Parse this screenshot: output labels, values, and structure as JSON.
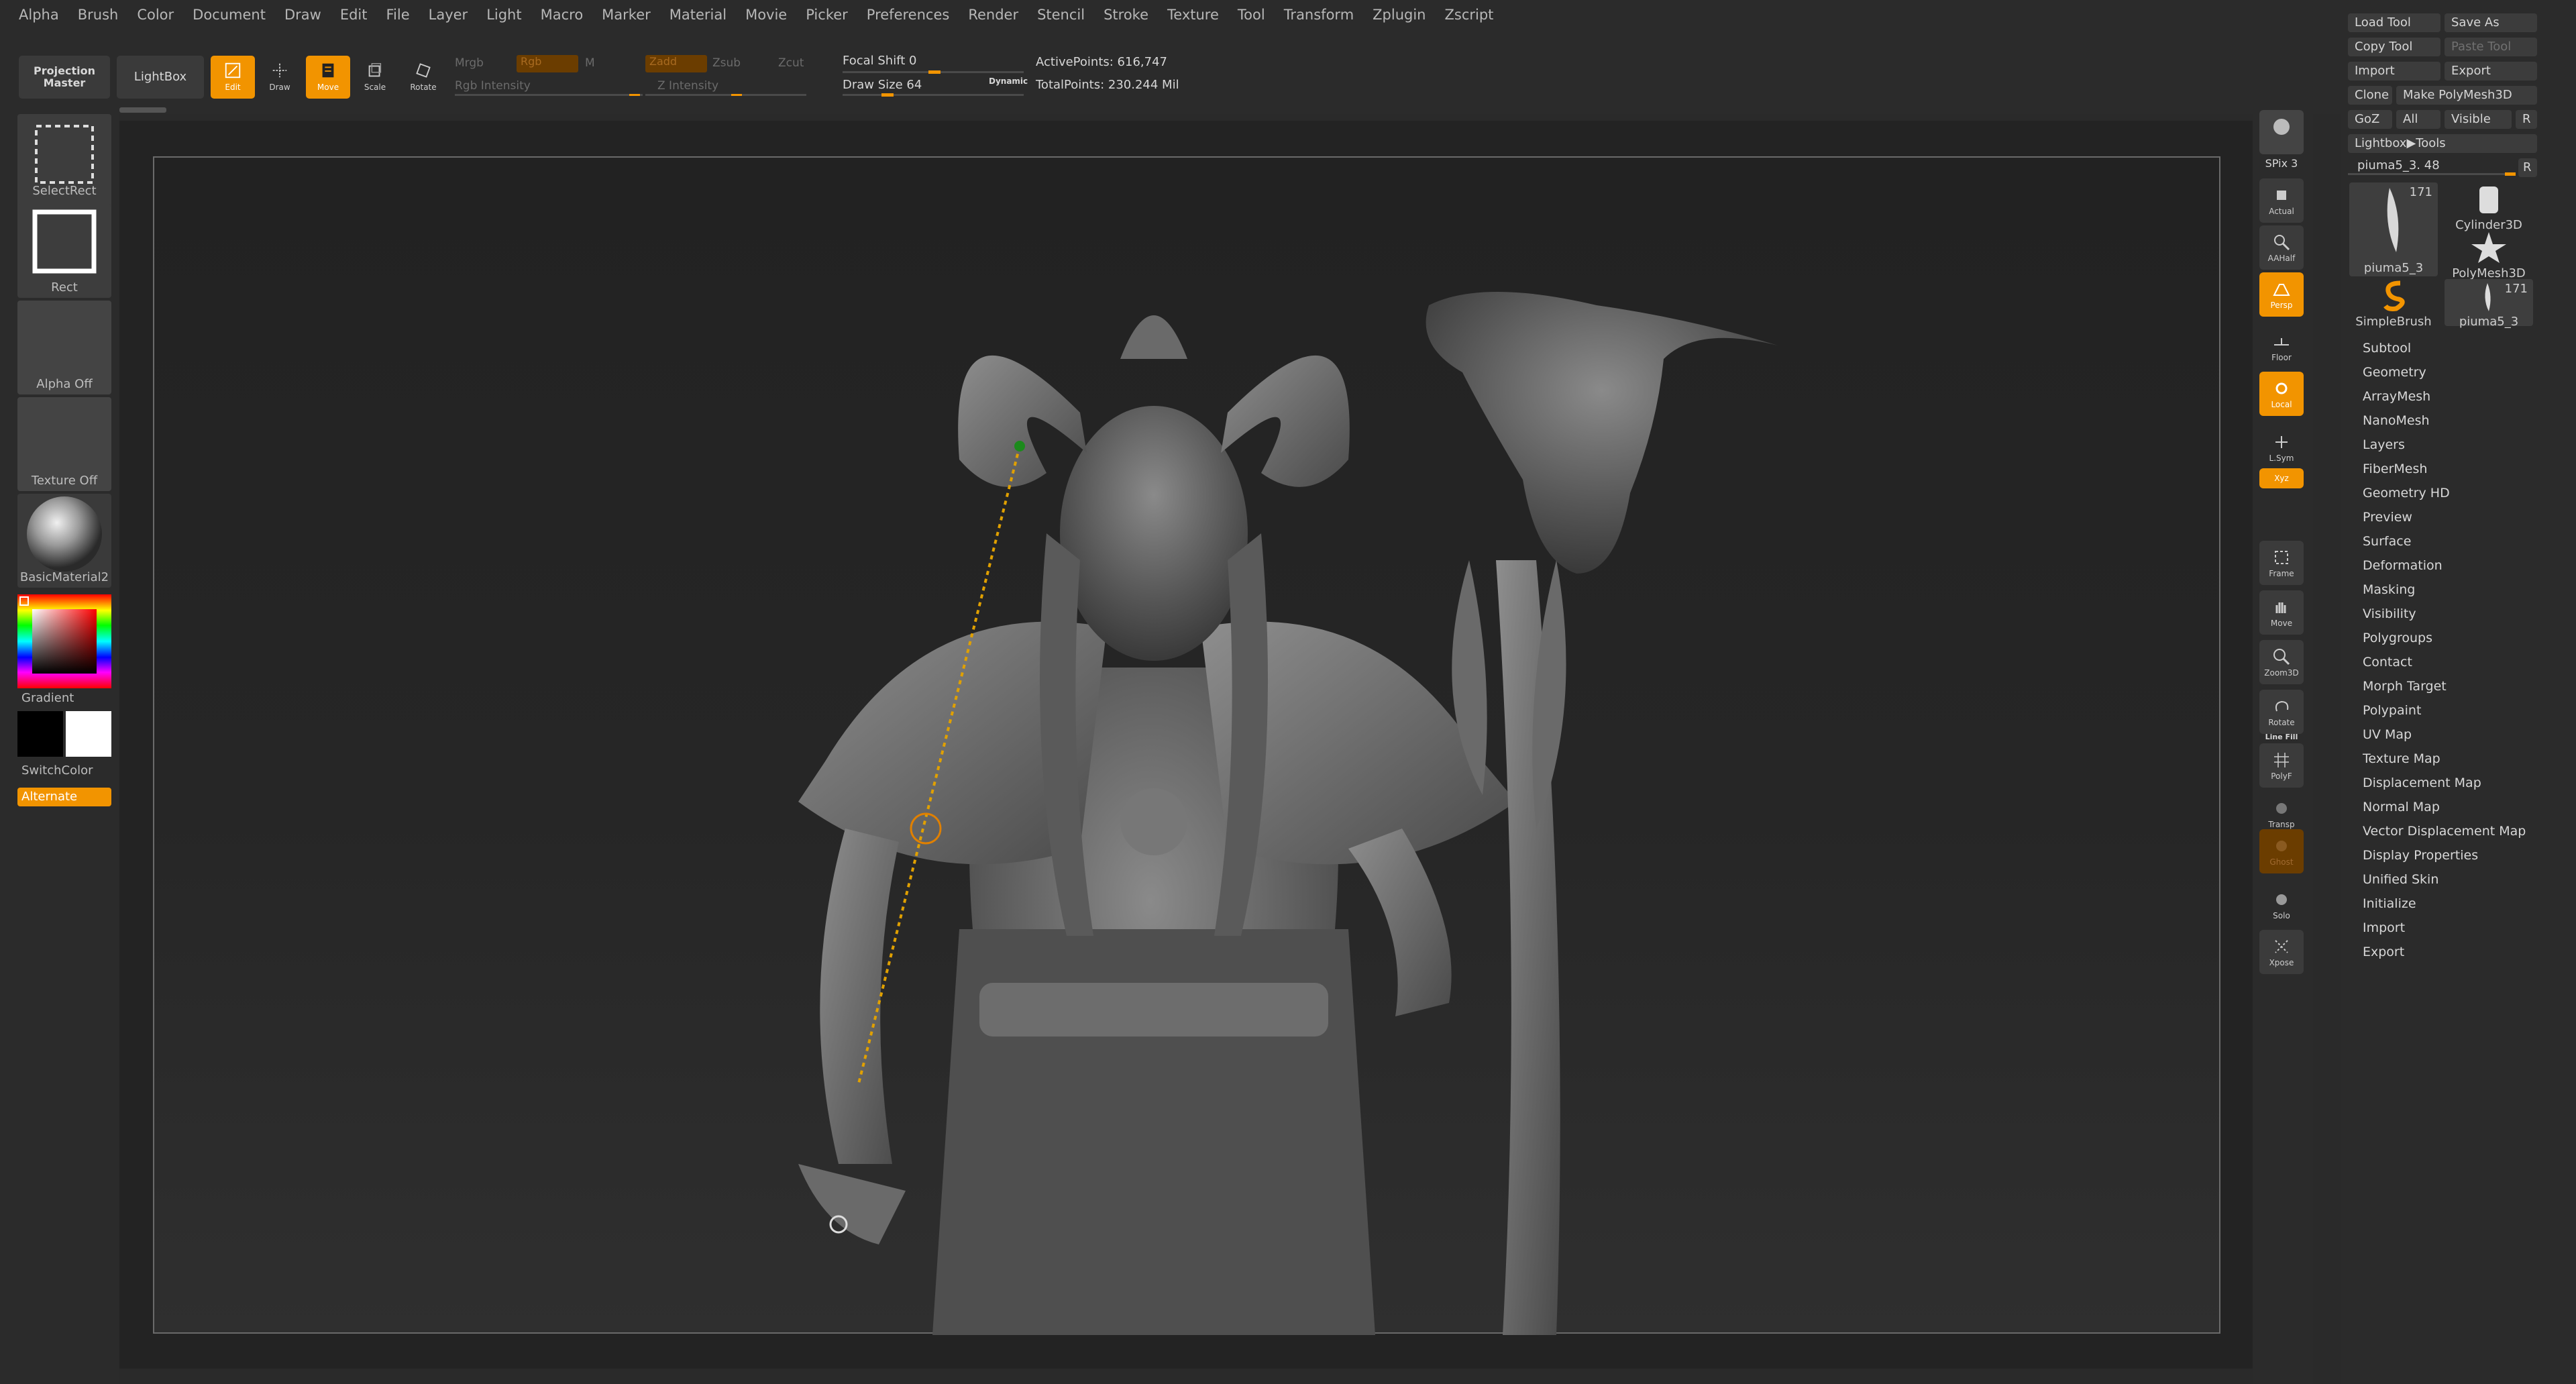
{
  "menu": [
    "Alpha",
    "Brush",
    "Color",
    "Document",
    "Draw",
    "Edit",
    "File",
    "Layer",
    "Light",
    "Macro",
    "Marker",
    "Material",
    "Movie",
    "Picker",
    "Preferences",
    "Render",
    "Stencil",
    "Stroke",
    "Texture",
    "Tool",
    "Transform",
    "Zplugin",
    "Zscript"
  ],
  "shelf": {
    "projection_master": "Projection Master",
    "lightbox": "LightBox",
    "tools": [
      {
        "label": "Edit",
        "icon": "edit-icon",
        "active": true
      },
      {
        "label": "Draw",
        "icon": "draw-icon",
        "active": false
      },
      {
        "label": "Move",
        "icon": "move-icon",
        "active": true
      },
      {
        "label": "Scale",
        "icon": "scale-icon",
        "active": false
      },
      {
        "label": "Rotate",
        "icon": "rotate-icon",
        "active": false
      }
    ],
    "mrgb": "Mrgb",
    "rgb": "Rgb",
    "m": "M",
    "rgb_intensity": "Rgb Intensity",
    "zadd": "Zadd",
    "zsub": "Zsub",
    "zcut": "Zcut",
    "z_intensity": "Z Intensity",
    "focal_shift": "Focal Shift 0",
    "draw_size": "Draw Size 64",
    "dynamic": "Dynamic",
    "active_points": "ActivePoints: 616,747",
    "total_points": "TotalPoints: 230.244 Mil"
  },
  "left_tray": {
    "select_rect": "SelectRect",
    "rect": "Rect",
    "alpha_off": "Alpha Off",
    "texture_off": "Texture Off",
    "material": "BasicMaterial2",
    "gradient": "Gradient",
    "switch_color": "SwitchColor",
    "alternate": "Alternate"
  },
  "right_strip": {
    "spix": "SPix 3",
    "buttons": [
      "Actual",
      "AAHalf",
      "Persp",
      "Floor",
      "Local",
      "L.Sym",
      "Xyz",
      "Frame",
      "Move",
      "Zoom3D",
      "Rotate",
      "Line Fill",
      "PolyF",
      "Transp",
      "Ghost",
      "Solo",
      "Xpose"
    ]
  },
  "palette": {
    "load_tool": "Load Tool",
    "save_as": "Save As",
    "copy_tool": "Copy Tool",
    "paste_tool": "Paste Tool",
    "import": "Import",
    "export": "Export",
    "clone": "Clone",
    "make_polymesh": "Make PolyMesh3D",
    "goz": "GoZ",
    "all": "All",
    "visible": "Visible",
    "r": "R",
    "lightbox_tools": "Lightbox▶Tools",
    "current_tool": "piuma5_3. 48",
    "thumbs": [
      {
        "caption": "piuma5_3",
        "count": "171"
      },
      {
        "caption": "Cylinder3D",
        "count": ""
      },
      {
        "caption": "PolyMesh3D",
        "count": ""
      },
      {
        "caption": "SimpleBrush",
        "count": ""
      },
      {
        "caption": "piuma5_3",
        "count": "171"
      }
    ],
    "subpalettes": [
      "Subtool",
      "Geometry",
      "ArrayMesh",
      "NanoMesh",
      "Layers",
      "FiberMesh",
      "Geometry HD",
      "Preview",
      "Surface",
      "Deformation",
      "Masking",
      "Visibility",
      "Polygroups",
      "Contact",
      "Morph Target",
      "Polypaint",
      "UV Map",
      "Texture Map",
      "Displacement Map",
      "Normal Map",
      "Vector Displacement Map",
      "Display Properties",
      "Unified Skin",
      "Initialize",
      "Import",
      "Export"
    ]
  },
  "colors": {
    "accent": "#f29400",
    "bg": "#2b2b2b",
    "viewport": "#232323"
  }
}
